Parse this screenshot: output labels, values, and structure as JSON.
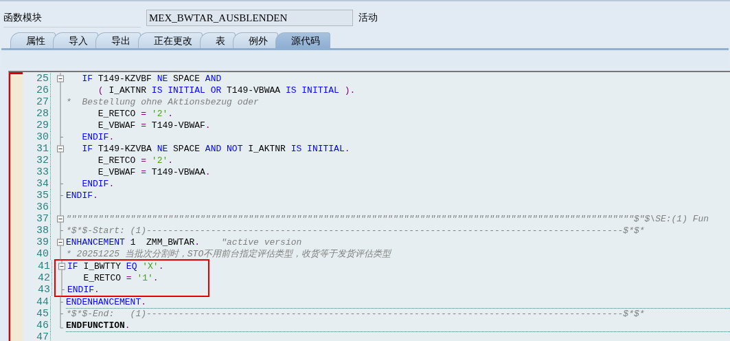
{
  "header": {
    "label": "函数模块",
    "name_value": "MEX_BWTAR_AUSBLENDEN",
    "status": "活动"
  },
  "tabs": [
    {
      "label": "属性",
      "selected": false
    },
    {
      "label": "导入",
      "selected": false
    },
    {
      "label": "导出",
      "selected": false
    },
    {
      "label": "正在更改",
      "selected": false
    },
    {
      "label": "表",
      "selected": false
    },
    {
      "label": "例外",
      "selected": false
    },
    {
      "label": "源代码",
      "selected": true
    }
  ],
  "editor": {
    "lines": [
      {
        "number": "25",
        "kind": "box",
        "tokens": [
          {
            "kind": "kw",
            "text": "   IF"
          },
          {
            "kind": "id",
            "text": " T149-KZVBF "
          },
          {
            "kind": "kw",
            "text": "NE"
          },
          {
            "kind": "id",
            "text": " SPACE "
          },
          {
            "kind": "kw",
            "text": "AND"
          }
        ]
      },
      {
        "number": "26",
        "kind": "bar",
        "tokens": [
          {
            "kind": "op",
            "text": "      ("
          },
          {
            "kind": "id",
            "text": " I_AKTNR "
          },
          {
            "kind": "kw",
            "text": "IS INITIAL OR"
          },
          {
            "kind": "id",
            "text": " T149-VBWAA "
          },
          {
            "kind": "kw",
            "text": "IS INITIAL"
          },
          {
            "kind": "op",
            "text": " )."
          }
        ]
      },
      {
        "number": "27",
        "kind": "bar",
        "tokens": [
          {
            "kind": "cm",
            "text": "*  Bestellung ohne Aktionsbezug oder"
          }
        ]
      },
      {
        "number": "28",
        "kind": "bar",
        "tokens": [
          {
            "kind": "id",
            "text": "      E_RETCO "
          },
          {
            "kind": "op",
            "text": "= "
          },
          {
            "kind": "str",
            "text": "'2'"
          },
          {
            "kind": "op",
            "text": "."
          }
        ]
      },
      {
        "number": "29",
        "kind": "bar",
        "tokens": [
          {
            "kind": "id",
            "text": "      E_VBWAF "
          },
          {
            "kind": "op",
            "text": "="
          },
          {
            "kind": "id",
            "text": " T149-VBWAF"
          },
          {
            "kind": "op",
            "text": "."
          }
        ]
      },
      {
        "number": "30",
        "kind": "tick",
        "tokens": [
          {
            "kind": "kw",
            "text": "   ENDIF"
          },
          {
            "kind": "op",
            "text": "."
          }
        ]
      },
      {
        "number": "31",
        "kind": "box",
        "tokens": [
          {
            "kind": "kw",
            "text": "   IF"
          },
          {
            "kind": "id",
            "text": " T149-KZVBA "
          },
          {
            "kind": "kw",
            "text": "NE"
          },
          {
            "kind": "id",
            "text": " SPACE "
          },
          {
            "kind": "kw",
            "text": "AND NOT"
          },
          {
            "kind": "id",
            "text": " I_AKTNR "
          },
          {
            "kind": "kw",
            "text": "IS INITIAL"
          },
          {
            "kind": "op",
            "text": "."
          }
        ]
      },
      {
        "number": "32",
        "kind": "bar",
        "tokens": [
          {
            "kind": "id",
            "text": "      E_RETCO "
          },
          {
            "kind": "op",
            "text": "= "
          },
          {
            "kind": "str",
            "text": "'2'"
          },
          {
            "kind": "op",
            "text": "."
          }
        ]
      },
      {
        "number": "33",
        "kind": "bar",
        "tokens": [
          {
            "kind": "id",
            "text": "      E_VBWAF "
          },
          {
            "kind": "op",
            "text": "="
          },
          {
            "kind": "id",
            "text": " T149-VBWAA"
          },
          {
            "kind": "op",
            "text": "."
          }
        ]
      },
      {
        "number": "34",
        "kind": "tick",
        "tokens": [
          {
            "kind": "kw",
            "text": "   ENDIF"
          },
          {
            "kind": "op",
            "text": "."
          }
        ]
      },
      {
        "number": "35",
        "kind": "tick",
        "tokens": [
          {
            "kind": "kw",
            "text": "ENDIF"
          },
          {
            "kind": "op",
            "text": "."
          }
        ]
      },
      {
        "number": "36",
        "kind": "bar"
      },
      {
        "number": "37",
        "kind": "box",
        "tokens": [
          {
            "kind": "cm",
            "text": "\"\"\"\"\"\"\"\"\"\"\"\"\"\"\"\"\"\"\"\"\"\"\"\"\"\"\"\"\"\"\"\"\"\"\"\"\"\"\"\"\"\"\"\"\"\"\"\"\"\"\"\"\"\"\"\"\"\"\"\"\"\"\"\"\"\"\"\"\"\"\"\"\"\"\"\"\"\"\"\"\"\"\"\"\"\"\"\"\"\"\"\"\"\"\"\"\"\"\"\"\"\"\"\"\"\"$\"$\\SE:(1) Fun"
          }
        ]
      },
      {
        "number": "38",
        "kind": "tick",
        "tokens": [
          {
            "kind": "cm",
            "text": "*$*$-Start: (1)-----------------------------------------------------------------------------------------$*$*"
          }
        ]
      },
      {
        "number": "39",
        "kind": "box",
        "tokens": [
          {
            "kind": "kw",
            "text": "ENHANCEMENT"
          },
          {
            "kind": "id",
            "text": " 1  ZMM_BWTAR"
          },
          {
            "kind": "op",
            "text": ".    "
          },
          {
            "kind": "cm",
            "text": "\"active version"
          }
        ]
      },
      {
        "number": "40",
        "kind": "bar",
        "tokens": [
          {
            "kind": "cm",
            "text": "* 20251225 当批次分割时，STO不用前台指定评估类型，收货等于发货评估类型"
          }
        ]
      },
      {
        "number": "41",
        "kind": "box",
        "highlighted": true,
        "tokens": [
          {
            "kind": "kw",
            "text": "IF"
          },
          {
            "kind": "id",
            "text": " I_BWTTY "
          },
          {
            "kind": "kw",
            "text": "EQ"
          },
          {
            "kind": "str",
            "text": " 'X'"
          },
          {
            "kind": "op",
            "text": "."
          }
        ]
      },
      {
        "number": "42",
        "kind": "bar",
        "highlighted": true,
        "tokens": [
          {
            "kind": "id",
            "text": "   E_RETCO "
          },
          {
            "kind": "op",
            "text": "= "
          },
          {
            "kind": "str",
            "text": "'1'"
          },
          {
            "kind": "op",
            "text": "."
          }
        ]
      },
      {
        "number": "43",
        "kind": "tick",
        "highlighted": true,
        "tokens": [
          {
            "kind": "kw",
            "text": "ENDIF"
          },
          {
            "kind": "op",
            "text": "."
          }
        ]
      },
      {
        "number": "44",
        "kind": "tick",
        "rule": true,
        "tokens": [
          {
            "kind": "kw",
            "text": "ENDENHANCEMENT"
          },
          {
            "kind": "op",
            "text": "."
          }
        ]
      },
      {
        "number": "45",
        "kind": "tick",
        "tokens": [
          {
            "kind": "cm",
            "text": "*$*$-End:   (1)-----------------------------------------------------------------------------------------$*$*"
          }
        ]
      },
      {
        "number": "46",
        "kind": "end",
        "rule": true,
        "tokens": [
          {
            "kind": "bold",
            "text": "ENDFUNCTION"
          },
          {
            "kind": "op",
            "text": "."
          }
        ]
      },
      {
        "number": "47",
        "kind": "none"
      }
    ]
  }
}
